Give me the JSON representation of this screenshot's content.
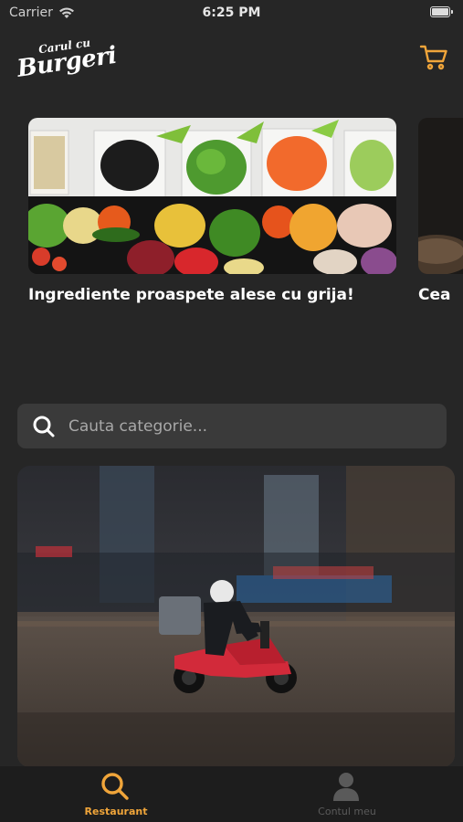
{
  "status_bar": {
    "carrier": "Carrier",
    "time": "6:25 PM"
  },
  "header": {
    "logo_small": "Carul cu",
    "logo_big": "Burgeri",
    "cart_icon": "cart-icon"
  },
  "carousel": {
    "slides": [
      {
        "caption": "Ingrediente proaspete alese cu grija!"
      },
      {
        "caption": "Cea"
      }
    ]
  },
  "search": {
    "placeholder": "Cauta categorie..."
  },
  "tab_bar": {
    "items": [
      {
        "label": "Restaurant",
        "icon": "search-icon",
        "active": true
      },
      {
        "label": "Contul meu",
        "icon": "user-icon",
        "active": false
      }
    ]
  },
  "colors": {
    "accent": "#F0A53A",
    "background": "#262626",
    "search_bg": "#3A3A3A",
    "tab_bar_bg": "#1D1D1D",
    "inactive_tab": "#5A5A5A"
  }
}
